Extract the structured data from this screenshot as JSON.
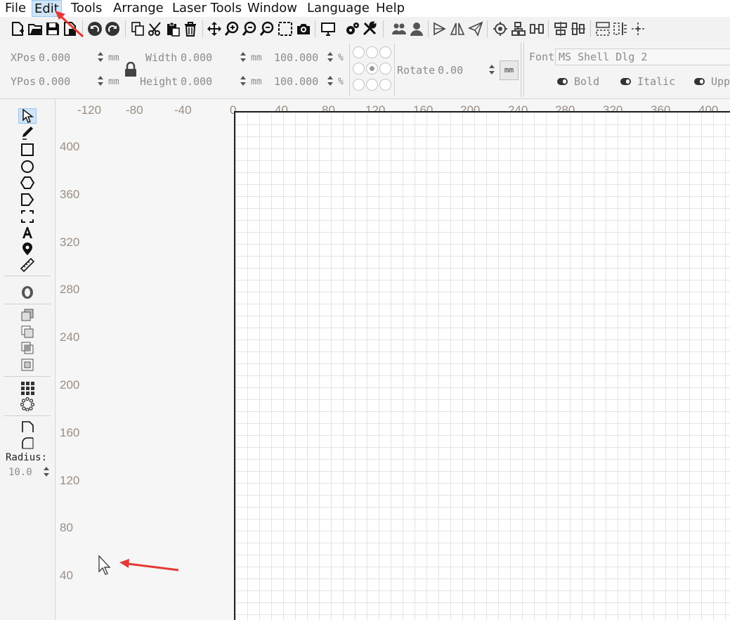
{
  "menu": {
    "items": [
      "File",
      "Edit",
      "Tools",
      "Arrange",
      "Laser Tools",
      "Window",
      "Language",
      "Help"
    ],
    "active": "Edit"
  },
  "toolbar": {
    "icons": [
      "new-file",
      "open-folder",
      "save",
      "save-as",
      "undo",
      "redo",
      "copy",
      "cut",
      "paste",
      "delete",
      "pan",
      "zoom-in",
      "zoom",
      "zoom-out",
      "zoom-selection",
      "capture",
      "monitor",
      "settings",
      "tools",
      "group",
      "user",
      "mirror-h",
      "mirror-v",
      "send",
      "target",
      "align",
      "distribute",
      "align-center",
      "align-middle",
      "arrange",
      "dock",
      "move"
    ]
  },
  "properties": {
    "xpos_label": "XPos",
    "xpos_value": "0.000",
    "ypos_label": "YPos",
    "ypos_value": "0.000",
    "width_label": "Width",
    "width_value": "0.000",
    "height_label": "Height",
    "height_value": "0.000",
    "unit_mm": "mm",
    "scale_w": "100.000",
    "scale_h": "100.000",
    "percent": "%",
    "rotate_label": "Rotate",
    "rotate_value": "0.00",
    "units_button": "mm",
    "font_label": "Font",
    "font_value": "MS Shell Dlg 2",
    "bold_label": "Bold",
    "italic_label": "Italic",
    "upper_label": "Upp"
  },
  "toolbox": {
    "tools": [
      "select",
      "pen",
      "rectangle",
      "ellipse",
      "polygon",
      "position",
      "frame",
      "text",
      "marker",
      "measure",
      "offset",
      "union",
      "subtract",
      "intersect",
      "weld",
      "grid-array",
      "circular-array",
      "corner",
      "round-corner"
    ],
    "radius_label": "Radius:",
    "radius_value": "10.0"
  },
  "rulers": {
    "horizontal": [
      "-120",
      "-80",
      "-40",
      "0",
      "40",
      "80",
      "120",
      "160",
      "200",
      "240",
      "280",
      "320",
      "360",
      "400"
    ],
    "vertical": [
      "400",
      "360",
      "320",
      "280",
      "240",
      "200",
      "160",
      "120",
      "80",
      "40"
    ]
  },
  "annotations": {
    "arrow_color": "#e53935"
  }
}
